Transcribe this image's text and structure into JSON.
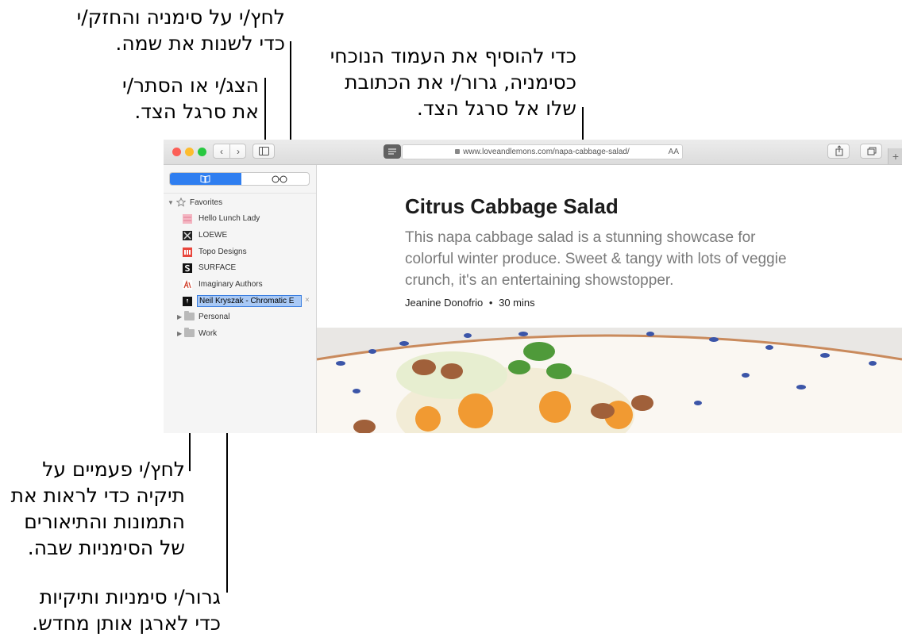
{
  "annotations": {
    "rename": [
      "לחץ/י על סימניה והחזק/י",
      "כדי לשנות את שמה."
    ],
    "add_bookmark": [
      "כדי להוסיף את העמוד הנוכחי",
      "כסימניה, גרור/י את הכתובת",
      "שלו אל סרגל הצד."
    ],
    "toggle_sidebar": [
      "הצג/י או הסתר/י",
      "את סרגל הצד."
    ],
    "double_click_folder": [
      "לחץ/י פעמיים על",
      "תיקיה כדי לראות את",
      "התמונות והתיאורים",
      "של הסימניות שבה."
    ],
    "drag_reorder": [
      "גרור/י סימניות ותיקיות",
      "כדי לארגן אותן מחדש."
    ]
  },
  "browser": {
    "url": "www.loveandlemons.com/napa-cabbage-salad/",
    "text_size_label": "AA",
    "new_tab_label": "+",
    "nav_back": "‹",
    "nav_forward": "›"
  },
  "sidebar": {
    "favorites_label": "Favorites",
    "bookmarks": [
      {
        "label": "Hello Lunch Lady",
        "icon": "hello-lunch-lady-favicon"
      },
      {
        "label": "LOEWE",
        "icon": "loewe-favicon"
      },
      {
        "label": "Topo Designs",
        "icon": "topo-designs-favicon"
      },
      {
        "label": "SURFACE",
        "icon": "surface-favicon"
      },
      {
        "label": "Imaginary Authors",
        "icon": "imaginary-authors-favicon"
      }
    ],
    "renaming_bookmark": "Neil Kryszak - Chromatic E",
    "folders": [
      {
        "label": "Personal"
      },
      {
        "label": "Work"
      }
    ]
  },
  "article": {
    "title": "Citrus Cabbage Salad",
    "subtitle": "This napa cabbage salad is a stunning showcase for colorful winter produce. Sweet & tangy with lots of veggie crunch, it's an entertaining showstopper.",
    "author": "Jeanine Donofrio",
    "separator": "•",
    "duration": "30 mins"
  },
  "colors": {
    "accent": "#2f7ef0",
    "close": "#fc5f57",
    "minimize": "#fdbc2e",
    "zoom": "#28c840"
  }
}
